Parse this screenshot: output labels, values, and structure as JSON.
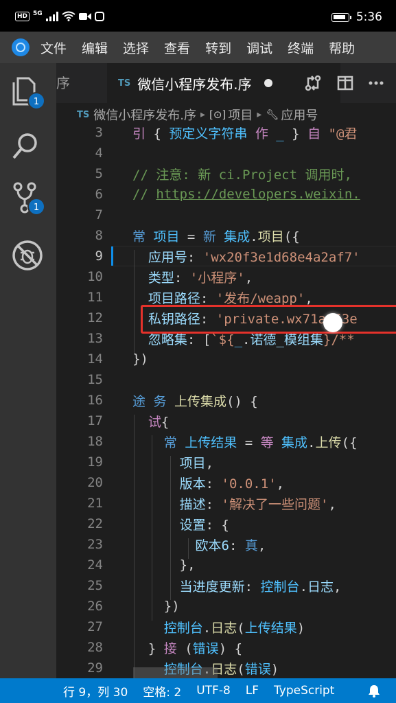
{
  "phone_status": {
    "network": "HD",
    "signal_label": "5G",
    "time": "5:36"
  },
  "menu": [
    "文件",
    "编辑",
    "选择",
    "查看",
    "转到",
    "调试",
    "终端",
    "帮助"
  ],
  "activity": {
    "explorer_badge": "1",
    "scm_badge": "1"
  },
  "tabs": {
    "inactive_label": "序",
    "active_icon": "TS",
    "active_label": "微信小程序发布.序"
  },
  "breadcrumb": {
    "file_icon": "TS",
    "file": "微信小程序发布.序",
    "symbol1": "项目",
    "symbol2": "应用号"
  },
  "editor": {
    "current_line": "9",
    "lines": [
      {
        "n": "3",
        "text": "引 { 预定义字符串 作 _ } 自 \"@君"
      },
      {
        "n": "4",
        "text": ""
      },
      {
        "n": "5",
        "text": "// 注意: 新 ci.Project 调用时,"
      },
      {
        "n": "6",
        "text": "// https://developers.weixin."
      },
      {
        "n": "7",
        "text": ""
      },
      {
        "n": "8",
        "text": "常 项目 = 新 集成.项目({"
      },
      {
        "n": "9",
        "text": "  应用号: 'wx20f3e1d68e4a2af7'"
      },
      {
        "n": "10",
        "text": "  类型: '小程序',"
      },
      {
        "n": "11",
        "text": "  项目路径: '发布/weapp',"
      },
      {
        "n": "12",
        "text": "  私钥路径: 'private.wx71a663e"
      },
      {
        "n": "13",
        "text": "  忽略集: [`${_.诺德_模组集}/**"
      },
      {
        "n": "14",
        "text": "})"
      },
      {
        "n": "15",
        "text": ""
      },
      {
        "n": "16",
        "text": "途 务 上传集成() {"
      },
      {
        "n": "17",
        "text": "  试{"
      },
      {
        "n": "18",
        "text": "    常 上传结果 = 等 集成.上传({"
      },
      {
        "n": "19",
        "text": "      项目,"
      },
      {
        "n": "20",
        "text": "      版本: '0.0.1',"
      },
      {
        "n": "21",
        "text": "      描述: '解决了一些问题',"
      },
      {
        "n": "22",
        "text": "      设置: {"
      },
      {
        "n": "23",
        "text": "        欧本6: 真,"
      },
      {
        "n": "24",
        "text": "      },"
      },
      {
        "n": "25",
        "text": "      当进度更新: 控制台.日志,"
      },
      {
        "n": "26",
        "text": "    })"
      },
      {
        "n": "27",
        "text": "    控制台.日志(上传结果)"
      },
      {
        "n": "28",
        "text": "  } 接 (错误) {"
      },
      {
        "n": "29",
        "text": "    控制台.日志(错误)"
      }
    ]
  },
  "statusbar": {
    "position": "行 9，列 30",
    "indent": "空格: 2",
    "encoding": "UTF-8",
    "eol": "LF",
    "language": "TypeScript"
  },
  "colors": {
    "accent": "#007acc",
    "highlight_box": "#e5322b",
    "badge": "#0e70c0"
  }
}
